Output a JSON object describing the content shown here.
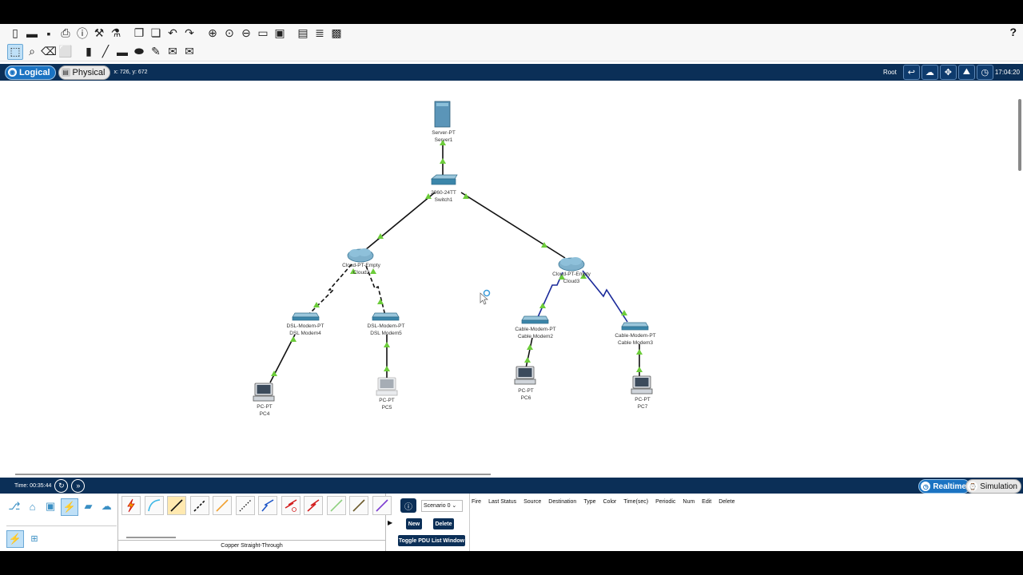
{
  "help_label": "?",
  "mode": {
    "logical_label": "Logical",
    "physical_label": "Physical",
    "coords": "x: 726, y: 672",
    "root_label": "Root",
    "clock": "17:04:20"
  },
  "devices": [
    {
      "id": "server1",
      "model": "Server-PT",
      "name": "Server1"
    },
    {
      "id": "switch1",
      "model": "2960-24TT",
      "name": "Switch1"
    },
    {
      "id": "cloud2",
      "model": "Cloud-PT-Empty",
      "name": "Cloud2"
    },
    {
      "id": "cloud3",
      "model": "Cloud-PT-Empty",
      "name": "Cloud3"
    },
    {
      "id": "dsl4",
      "model": "DSL-Modem-PT",
      "name": "DSL Modem4"
    },
    {
      "id": "dsl5",
      "model": "DSL-Modem-PT",
      "name": "DSL Modem5"
    },
    {
      "id": "cable2",
      "model": "Cable-Modem-PT",
      "name": "Cable Modem2"
    },
    {
      "id": "cable3",
      "model": "Cable-Modem-PT",
      "name": "Cable Modem3"
    },
    {
      "id": "pc4",
      "model": "PC-PT",
      "name": "PC4"
    },
    {
      "id": "pc5",
      "model": "PC-PT",
      "name": "PC5"
    },
    {
      "id": "pc6",
      "model": "PC-PT",
      "name": "PC6"
    },
    {
      "id": "pc7",
      "model": "PC-PT",
      "name": "PC7"
    }
  ],
  "status": {
    "time": "Time: 00:35:44",
    "realtime_label": "Realtime",
    "simulation_label": "Simulation"
  },
  "connections": {
    "selected_label": "Copper Straight-Through"
  },
  "pdu": {
    "scenario": "Scenario 0",
    "new_label": "New",
    "delete_label": "Delete",
    "toggle_label": "Toggle PDU List Window",
    "columns": [
      "Fire",
      "Last Status",
      "Source",
      "Destination",
      "Type",
      "Color",
      "Time(sec)",
      "Periodic",
      "Num",
      "Edit",
      "Delete"
    ]
  },
  "colors": {
    "accent": "#1a73c2",
    "bar": "#0b2f57",
    "link_up": "#66cc33"
  }
}
